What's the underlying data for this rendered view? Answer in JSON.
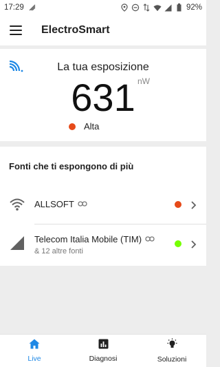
{
  "status_bar": {
    "time": "17:29",
    "battery": "92%"
  },
  "app": {
    "title": "ElectroSmart"
  },
  "exposure": {
    "title": "La tua esposizione",
    "value": "631",
    "unit": "nW",
    "level": "Alta",
    "level_color": "#e64a19"
  },
  "sources": {
    "title": "Fonti che ti espongono di più",
    "items": [
      {
        "name": "ALLSOFT",
        "subtitle": "",
        "icon": "wifi-icon",
        "dot_color": "#e64a19"
      },
      {
        "name": "Telecom Italia Mobile (TIM)",
        "subtitle": "& 12 altre fonti",
        "icon": "cellular-icon",
        "dot_color": "#76ff03"
      }
    ]
  },
  "bottom_nav": {
    "items": [
      {
        "label": "Live",
        "icon": "home-icon",
        "active": true
      },
      {
        "label": "Diagnosi",
        "icon": "chart-icon",
        "active": false
      },
      {
        "label": "Soluzioni",
        "icon": "bulb-icon",
        "active": false
      }
    ],
    "accent": "#1e88e5"
  }
}
